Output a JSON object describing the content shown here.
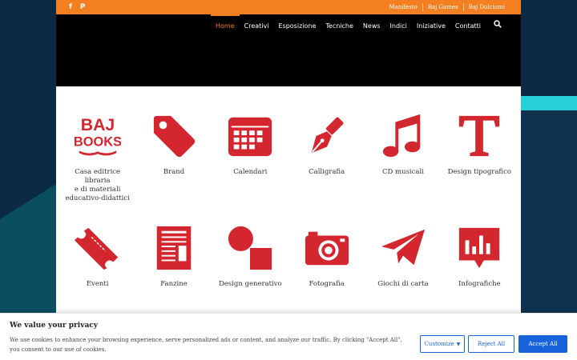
{
  "colors": {
    "accent": "#f47f20",
    "icon_red": "#d3262f",
    "cookie_blue": "#1863dc"
  },
  "topbar": {
    "social": [
      {
        "icon": "facebook-icon",
        "glyph": "f"
      },
      {
        "icon": "pinterest-icon",
        "glyph": "P"
      }
    ],
    "links": [
      "Manifesto",
      "Baj Games",
      "Baj Dolciumi"
    ]
  },
  "nav": {
    "items": [
      "Home",
      "Creativi",
      "Esposizione",
      "Tecniche",
      "News",
      "Indici",
      "Iniziative",
      "Contatti"
    ],
    "search_icon": "search-icon"
  },
  "logo": {
    "line1": "BAJ",
    "line2": "BOOKS"
  },
  "tiles_row1": [
    {
      "label": "Casa editrice\nlibraria\ne di materiali\neducativo-didattici",
      "icon": "baj-books-logo"
    },
    {
      "label": "Brand",
      "icon": "tag-icon"
    },
    {
      "label": "Calendari",
      "icon": "calendar-icon"
    },
    {
      "label": "Calligrafia",
      "icon": "fountain-pen-icon"
    },
    {
      "label": "CD musicali",
      "icon": "music-note-icon"
    },
    {
      "label": "Design tipografico",
      "icon": "typography-t-icon"
    }
  ],
  "tiles_row2": [
    {
      "label": "Eventi",
      "icon": "ticket-icon"
    },
    {
      "label": "Fanzine",
      "icon": "newspaper-icon"
    },
    {
      "label": "Design generativo",
      "icon": "shapes-icon"
    },
    {
      "label": "Fotografia",
      "icon": "camera-icon"
    },
    {
      "label": "Giochi di carta",
      "icon": "paper-plane-icon"
    },
    {
      "label": "Infografiche",
      "icon": "chart-bubble-icon"
    }
  ],
  "cookie": {
    "title": "We value your privacy",
    "text": "We use cookies to enhance your browsing experience, serve personalized ads or content, and analyze our traffic. By clicking \"Accept All\", you consent to our use of cookies.",
    "customize": "Customize",
    "reject": "Reject All",
    "accept": "Accept All"
  }
}
